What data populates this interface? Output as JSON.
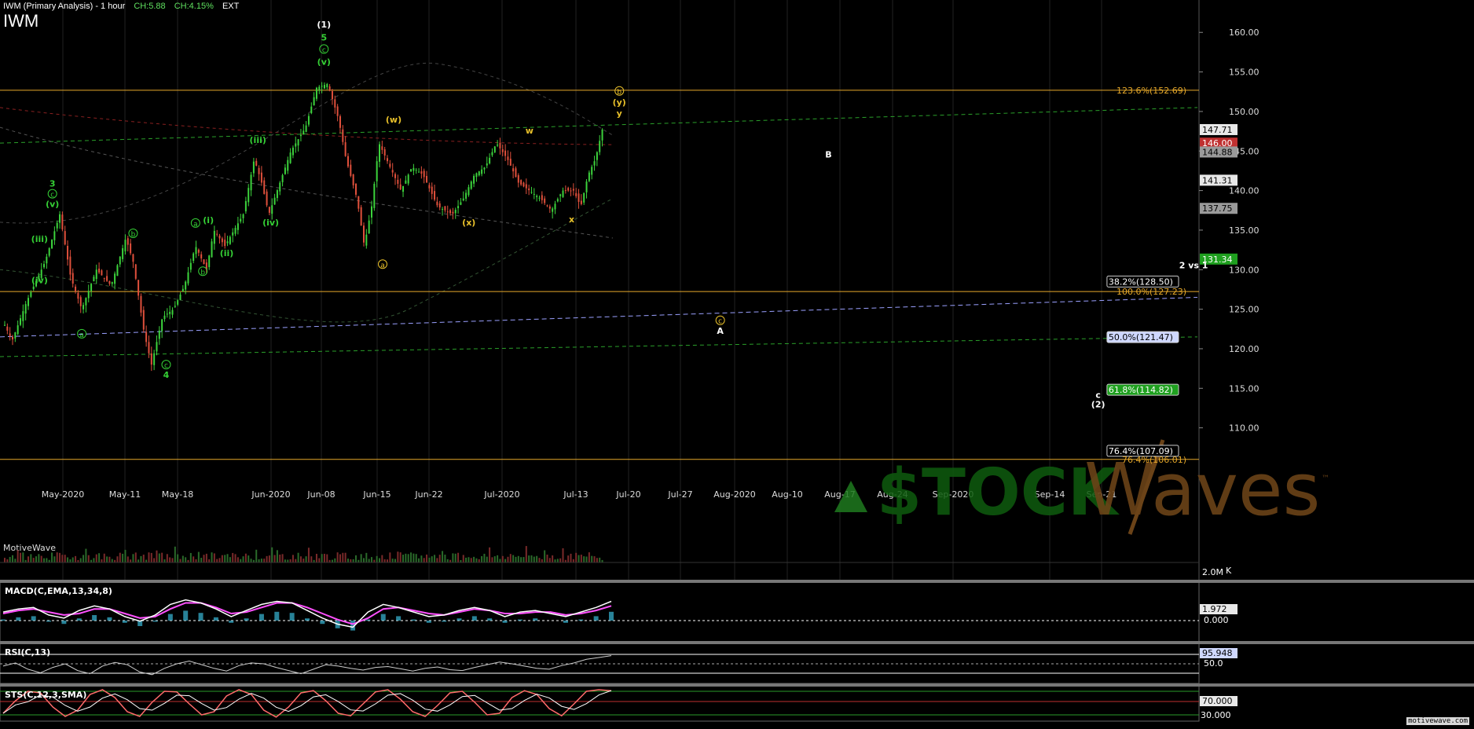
{
  "header": {
    "title": "IWM (Primary Analysis) - 1 hour",
    "change_abs": "CH:5.88",
    "change_pct": "CH:4.15%",
    "session": "EXT",
    "symbol": "IWM"
  },
  "watermark": {
    "brand_left": "$TOCK",
    "brand_right": "Waves",
    "tm": "™",
    "platform": "MotiveWave"
  },
  "credit": "motivewave.com",
  "colors": {
    "background": "#000000",
    "up_candle": "#3cd33c",
    "down_candle": "#e0503c",
    "fib_line": "#e6a82a",
    "wave_green": "#35d035",
    "wave_yellow": "#e8c02a",
    "macd_line": "#ffffff",
    "macd_signal": "#ff50ff",
    "macd_hist": "#39b9d9",
    "stoch_k": "#ff6a6a",
    "stoch_d": "#ffffff",
    "price_label_green": "#1fa01f"
  },
  "chart_data": {
    "type": "candlestick",
    "title": "IWM (Primary Analysis) - 1 hour",
    "x_ticks": [
      "May-2020",
      "May-11",
      "May-18",
      "Jun-2020",
      "Jun-08",
      "Jun-15",
      "Jun-22",
      "Jul-2020",
      "Jul-13",
      "Jul-20",
      "Jul-27",
      "Aug-2020",
      "Aug-10",
      "Aug-17",
      "Aug-24",
      "Sep-2020",
      "Sep-14",
      "Sep-21"
    ],
    "y_ticks": [
      160,
      155,
      150,
      145,
      140,
      135,
      130,
      125,
      120,
      115,
      110
    ],
    "ylim": [
      104.5,
      163.5
    ],
    "price_path": [
      [
        0,
        123
      ],
      [
        0.4,
        121
      ],
      [
        1.2,
        126
      ],
      [
        2.2,
        131
      ],
      [
        3.0,
        137
      ],
      [
        3.6,
        129
      ],
      [
        4.2,
        125
      ],
      [
        5.0,
        130
      ],
      [
        5.8,
        128
      ],
      [
        6.6,
        134
      ],
      [
        7.0,
        131
      ],
      [
        7.6,
        122
      ],
      [
        8.0,
        118
      ],
      [
        8.6,
        124
      ],
      [
        9.2,
        125
      ],
      [
        9.8,
        128
      ],
      [
        10.4,
        133
      ],
      [
        11.0,
        130
      ],
      [
        11.4,
        135
      ],
      [
        12.0,
        133
      ],
      [
        13.0,
        137
      ],
      [
        13.6,
        144
      ],
      [
        14.0,
        141
      ],
      [
        14.4,
        137
      ],
      [
        15.0,
        141
      ],
      [
        15.6,
        145
      ],
      [
        16.4,
        148
      ],
      [
        17.0,
        153
      ],
      [
        17.6,
        153.5
      ],
      [
        18.2,
        149
      ],
      [
        18.6,
        144
      ],
      [
        19.2,
        139
      ],
      [
        19.6,
        133
      ],
      [
        20.0,
        138
      ],
      [
        20.4,
        146
      ],
      [
        21.0,
        143
      ],
      [
        21.6,
        140
      ],
      [
        22.2,
        143
      ],
      [
        22.8,
        142
      ],
      [
        23.6,
        138
      ],
      [
        24.4,
        137
      ],
      [
        25.0,
        139
      ],
      [
        25.6,
        142
      ],
      [
        26.2,
        143
      ],
      [
        26.8,
        146
      ],
      [
        27.4,
        144
      ],
      [
        28.0,
        141
      ],
      [
        28.6,
        140
      ],
      [
        29.2,
        139
      ],
      [
        29.8,
        137.5
      ],
      [
        30.4,
        140
      ],
      [
        31.0,
        140
      ],
      [
        31.4,
        138
      ],
      [
        31.8,
        142
      ],
      [
        32.2,
        144
      ],
      [
        32.6,
        148
      ]
    ],
    "last_price": "147.71",
    "price_labels": [
      {
        "text": "147.71",
        "price": 147.71,
        "style": "white"
      },
      {
        "text": "146.00",
        "price": 146.0,
        "style": "red"
      },
      {
        "text": "144.88",
        "price": 144.88,
        "style": "gray"
      },
      {
        "text": "141.31",
        "price": 141.31,
        "style": "white"
      },
      {
        "text": "137.75",
        "price": 137.75,
        "style": "gray"
      },
      {
        "text": "131.34",
        "price": 131.34,
        "style": "green"
      }
    ],
    "fib_targets": [
      {
        "text": "123.6%(152.69)",
        "price": 152.69,
        "style": "orange"
      },
      {
        "text": "38.2%(128.50)",
        "price": 128.5,
        "style": "white"
      },
      {
        "text": "100.0%(127.23)",
        "price": 127.23,
        "style": "orange"
      },
      {
        "text": "50.0%(121.47)",
        "price": 121.47,
        "style": "blue"
      },
      {
        "text": "61.8%(114.82)",
        "price": 114.82,
        "style": "green"
      },
      {
        "text": "76.4%(107.09)",
        "price": 107.09,
        "style": "white"
      },
      {
        "text": "76.4%(106.01)",
        "price": 106.01,
        "style": "orange"
      }
    ],
    "wave_labels": [
      {
        "text": "(1)",
        "x": 17.4,
        "price": 160.6,
        "color": "white"
      },
      {
        "text": "5",
        "x": 17.4,
        "price": 159.0,
        "color": "green"
      },
      {
        "text": "c",
        "x": 17.4,
        "price": 157.5,
        "color": "green",
        "circle": true
      },
      {
        "text": "(v)",
        "x": 17.4,
        "price": 155.9,
        "color": "green"
      },
      {
        "text": "3",
        "x": 2.6,
        "price": 140.5,
        "color": "green"
      },
      {
        "text": "c",
        "x": 2.6,
        "price": 139.2,
        "color": "green",
        "circle": true
      },
      {
        "text": "(v)",
        "x": 2.6,
        "price": 137.9,
        "color": "green"
      },
      {
        "text": "(iii)",
        "x": 1.9,
        "price": 133.5,
        "color": "green"
      },
      {
        "text": "(iv)",
        "x": 1.9,
        "price": 128.3,
        "color": "green"
      },
      {
        "text": "a",
        "x": 4.2,
        "price": 121.5,
        "color": "green",
        "circle": true
      },
      {
        "text": "b",
        "x": 7.0,
        "price": 134.2,
        "color": "green",
        "circle": true
      },
      {
        "text": "c",
        "x": 8.8,
        "price": 117.6,
        "color": "green",
        "circle": true
      },
      {
        "text": "4",
        "x": 8.8,
        "price": 116.3,
        "color": "green"
      },
      {
        "text": "a",
        "x": 10.4,
        "price": 135.5,
        "color": "green",
        "circle": true
      },
      {
        "text": "(i)",
        "x": 11.1,
        "price": 135.9,
        "color": "green"
      },
      {
        "text": "b",
        "x": 10.8,
        "price": 129.4,
        "color": "green",
        "circle": true
      },
      {
        "text": "(ii)",
        "x": 12.1,
        "price": 131.7,
        "color": "green"
      },
      {
        "text": "(iii)",
        "x": 13.8,
        "price": 146.0,
        "color": "green"
      },
      {
        "text": "(iv)",
        "x": 14.5,
        "price": 135.6,
        "color": "green"
      },
      {
        "text": "(w)",
        "x": 21.2,
        "price": 148.6,
        "color": "yellow"
      },
      {
        "text": "a",
        "x": 20.6,
        "price": 130.3,
        "color": "yellow",
        "circle": true
      },
      {
        "text": "(x)",
        "x": 25.3,
        "price": 135.6,
        "color": "yellow"
      },
      {
        "text": "w",
        "x": 28.6,
        "price": 147.2,
        "color": "yellow"
      },
      {
        "text": "x",
        "x": 30.9,
        "price": 136.0,
        "color": "yellow"
      },
      {
        "text": "b",
        "x": 33.5,
        "price": 152.2,
        "color": "yellow",
        "circle": true
      },
      {
        "text": "(y)",
        "x": 33.5,
        "price": 150.8,
        "color": "yellow"
      },
      {
        "text": "y",
        "x": 33.5,
        "price": 149.4,
        "color": "yellow"
      },
      {
        "text": "c",
        "x": 39.0,
        "price": 123.2,
        "color": "yellow",
        "circle": true
      },
      {
        "text": "A",
        "x": 39.0,
        "price": 121.9,
        "color": "white"
      },
      {
        "text": "B",
        "x": 44.9,
        "price": 144.2,
        "color": "white"
      },
      {
        "text": "2 vs 1",
        "x": 64.8,
        "price": 130.2,
        "color": "white"
      },
      {
        "text": "c",
        "x": 59.6,
        "price": 113.8,
        "color": "white"
      },
      {
        "text": "(2)",
        "x": 59.6,
        "price": 112.6,
        "color": "white"
      }
    ],
    "volume_label": "2.0M",
    "volume_unit": "K",
    "macd": {
      "name": "MACD(C,EMA,13,34,8)",
      "value_label": "1.972",
      "zero_label": "0.000",
      "macd": [
        0.1,
        0.3,
        0.4,
        -0.1,
        -0.3,
        0.2,
        0.5,
        0.3,
        -0.2,
        -0.5,
        -0.1,
        0.6,
        0.9,
        0.7,
        0.3,
        -0.2,
        0.2,
        0.6,
        0.8,
        0.7,
        0.2,
        -0.3,
        -0.7,
        -0.9,
        0.1,
        0.6,
        0.4,
        0.1,
        -0.2,
        -0.1,
        0.2,
        0.4,
        0.2,
        -0.2,
        0.1,
        0.2,
        0.0,
        -0.2,
        0.1,
        0.4,
        0.8
      ],
      "signal": [
        0.0,
        0.2,
        0.3,
        0.1,
        -0.1,
        0.0,
        0.3,
        0.3,
        0.0,
        -0.3,
        -0.2,
        0.3,
        0.7,
        0.7,
        0.4,
        0.0,
        0.1,
        0.4,
        0.7,
        0.7,
        0.4,
        0.0,
        -0.4,
        -0.7,
        -0.3,
        0.3,
        0.4,
        0.2,
        0.0,
        -0.1,
        0.1,
        0.3,
        0.2,
        0.0,
        0.0,
        0.1,
        0.1,
        -0.1,
        0.0,
        0.2,
        0.5
      ]
    },
    "rsi": {
      "name": "RSI(C,13)",
      "value_label": "95.948",
      "level_label": "50.0",
      "values": [
        55,
        62,
        48,
        40,
        52,
        60,
        45,
        38,
        55,
        63,
        58,
        42,
        36,
        50,
        60,
        66,
        58,
        50,
        44,
        56,
        62,
        60,
        52,
        45,
        38,
        48,
        58,
        55,
        50,
        46,
        52,
        54,
        49,
        44,
        50,
        53,
        47,
        45,
        52,
        58,
        64,
        60,
        55,
        50,
        48,
        56,
        62,
        70,
        74,
        78
      ]
    },
    "stoch": {
      "name": "STS(C,12,3,SMA)",
      "value_label": "70.000",
      "low_label": "30.000",
      "values": [
        20,
        60,
        90,
        85,
        40,
        10,
        30,
        80,
        95,
        70,
        25,
        10,
        55,
        90,
        88,
        50,
        15,
        25,
        75,
        95,
        80,
        30,
        8,
        40,
        85,
        92,
        60,
        20,
        12,
        50,
        88,
        95,
        65,
        25,
        10,
        45,
        85,
        90,
        55,
        15,
        20,
        70,
        92,
        80,
        35,
        12,
        50,
        90,
        95,
        92
      ]
    }
  }
}
